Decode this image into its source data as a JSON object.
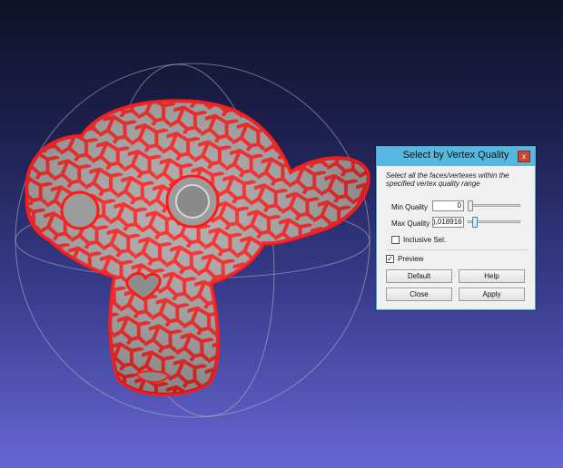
{
  "dialog": {
    "title": "Select by Vertex Quality",
    "close_glyph": "x",
    "description": "Select all the faces/vertexes within the specified vertex quality range",
    "min_quality": {
      "label": "Min Quality",
      "value": "0",
      "slider_fraction": 0.0
    },
    "max_quality": {
      "label": "Max Quality",
      "value": "),018916",
      "slider_fraction": 0.1
    },
    "inclusive": {
      "label": "Inclusive Sel.",
      "checked": false,
      "check_glyph": ""
    },
    "preview": {
      "label": "Preview",
      "checked": true,
      "check_glyph": "✓"
    },
    "buttons": {
      "default": "Default",
      "help": "Help",
      "close": "Close",
      "apply": "Apply"
    }
  },
  "colors": {
    "bg_top": "#0f1226",
    "bg_bottom": "#6666d2",
    "title_bar": "#56b8de",
    "mesh_surface": "#a7a7a7",
    "selection": "#ff1a1a",
    "trackball": "#b9b9c8"
  }
}
